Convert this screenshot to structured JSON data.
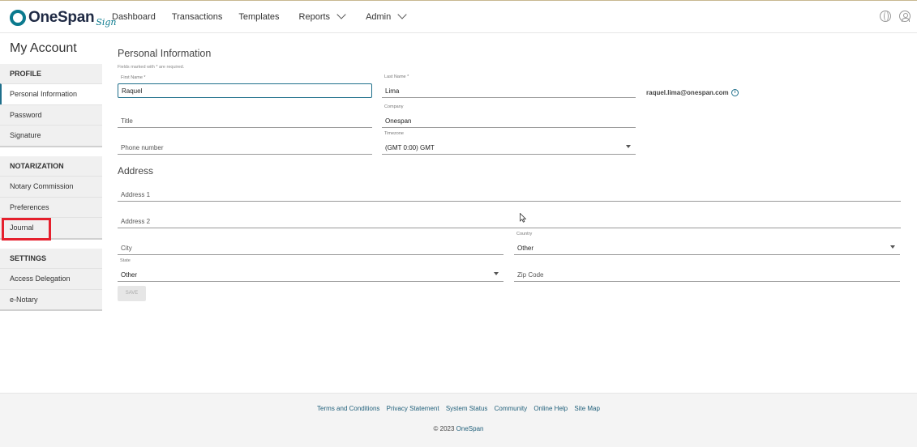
{
  "brand": {
    "name": "OneSpan",
    "sub": "Sign",
    "accent": "#0b7a8e"
  },
  "nav": {
    "items": [
      {
        "label": "Dashboard"
      },
      {
        "label": "Transactions"
      },
      {
        "label": "Templates"
      },
      {
        "label": "Reports"
      },
      {
        "label": "Admin"
      }
    ]
  },
  "sidebar": {
    "title": "My Account",
    "profile": {
      "head": "PROFILE",
      "items": [
        "Personal Information",
        "Password",
        "Signature"
      ]
    },
    "notarization": {
      "head": "NOTARIZATION",
      "items": [
        "Notary Commission",
        "Preferences",
        "Journal"
      ]
    },
    "settings": {
      "head": "SETTINGS",
      "items": [
        "Access Delegation",
        "e-Notary"
      ]
    },
    "highlight_color": "#e5202d"
  },
  "form": {
    "title": "Personal Information",
    "hint": "Fields marked with * are required.",
    "first_name": {
      "label": "First Name *",
      "value": "Raquel"
    },
    "last_name": {
      "label": "Last Name *",
      "value": "Lima"
    },
    "email": "raquel.lima@onespan.com",
    "info_glyph": "i",
    "title_field": {
      "placeholder": "Title"
    },
    "company": {
      "label": "Company",
      "value": "Onespan"
    },
    "phone": {
      "placeholder": "Phone number"
    },
    "timezone": {
      "label": "Timezone",
      "value": "(GMT 0:00) GMT"
    },
    "address_title": "Address",
    "address1": {
      "placeholder": "Address 1"
    },
    "address2": {
      "placeholder": "Address 2"
    },
    "city": {
      "placeholder": "City"
    },
    "country": {
      "label": "Country",
      "value": "Other"
    },
    "state": {
      "label": "State",
      "value": "Other"
    },
    "zip": {
      "placeholder": "Zip Code"
    },
    "save_label": "SAVE"
  },
  "footer": {
    "links": [
      "Terms and Conditions",
      "Privacy Statement",
      "System Status",
      "Community",
      "Online Help",
      "Site Map"
    ],
    "copyright_prefix": "© 2023 ",
    "copyright_brand": "OneSpan"
  }
}
